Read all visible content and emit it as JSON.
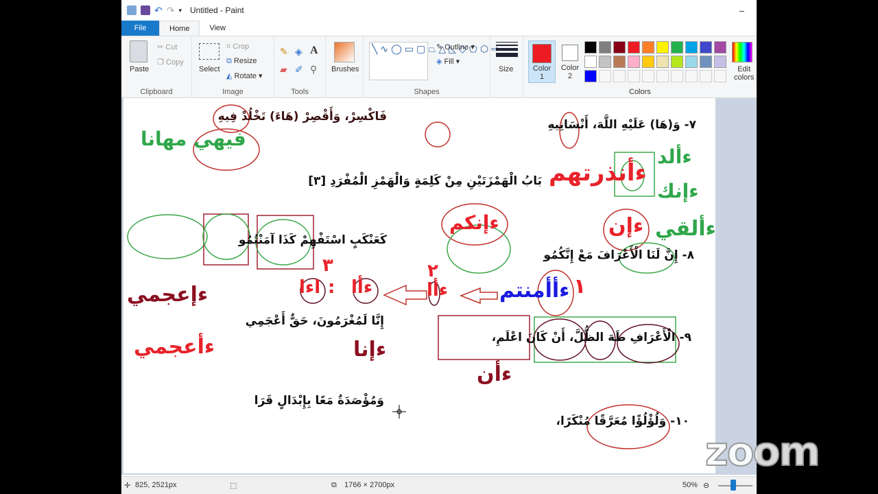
{
  "window": {
    "title": "Untitled - Paint",
    "minimize": "–"
  },
  "tabs": [
    "File",
    "Home",
    "View"
  ],
  "ribbon": {
    "clipboard": {
      "label": "Clipboard",
      "paste": "Paste",
      "cut": "Cut",
      "copy": "Copy"
    },
    "image": {
      "label": "Image",
      "select": "Select",
      "crop": "Crop",
      "resize": "Resize",
      "rotate": "Rotate"
    },
    "tools": {
      "label": "Tools"
    },
    "brushes": "Brushes",
    "shapes": {
      "label": "Shapes",
      "outline": "Outline",
      "fill": "Fill"
    },
    "size": "Size",
    "color1": "Color\n1",
    "color1_a": "Color",
    "color1_b": "1",
    "color2_a": "Color",
    "color2_b": "2",
    "colors_label": "Colors",
    "edit_colors_a": "Edit",
    "edit_colors_b": "colors",
    "color1_value": "#ed1c24",
    "color2_value": "#ffffff",
    "palette": [
      "#000000",
      "#7f7f7f",
      "#880015",
      "#ed1c24",
      "#ff7f27",
      "#fff200",
      "#22b14c",
      "#00a2e8",
      "#3f48cc",
      "#a349a4",
      "#ffffff",
      "#c3c3c3",
      "#b97a57",
      "#ffaec9",
      "#ffc90e",
      "#efe4b0",
      "#b5e61d",
      "#99d9ea",
      "#7092be",
      "#c8bfe7",
      "#0000ff"
    ]
  },
  "page": {
    "line7_right": "٧- وَ(هَا) عَلَيْهِ اللَّهَ، أَنْسَانِيهِ",
    "line7_left": "فَاكْسِرْ، وَأَقْصِرْ (هَاءَ) تَخْلُدْ فِيهِ",
    "note_fihi": "فيهي مهانا",
    "heading": "بَابُ الْهَمْزَتَيْنِ مِنْ كَلِمَةٍ وَالْهَمْزِ الْمُفْرَدِ [٣]",
    "note_andhartahum": "ءأنذرتهم",
    "note_alid": "ءألد",
    "note_innaka": "ءإنك",
    "note_ulqi": "ءألقي",
    "note_innakum": "ءإنكم",
    "note_in": "ءإن",
    "line8_right": "٨- إِنَّ لَنَا الْأَعْرَافَ مَعْ إِنَّكُمُو",
    "line8_left": "كَعَنْكَبٍ اسْتَفْهِمْ كَذَا آمَنْتُمُو",
    "note_aamantum": "ءأأمنتم",
    "num1": "١",
    "num2": "٢",
    "num3": "٣",
    "note_step2": "ءأا",
    "note_step3a": "ءأا",
    "note_colon": ":",
    "note_step3b": "اءا",
    "note_iajami_top": "ءإعجمي",
    "line9_left": "إِنَّا لَمُغْرَمُونَ، حَقٌّ أَعْجَمِي",
    "note_aajami": "ءأعجمي",
    "note_inna": "ءإنا",
    "line9_right": "٩- الْأَعْرَافِ طَهَ الظُّلَّ، أَنْ كَانَ اعْلَمِ،",
    "note_an": "ءأن",
    "line10_left": "وَمُؤْصَدَةٌ مَعًا بِإِبْدَالٍ قَرَا",
    "line10_right": "١٠- وَلُؤْلُؤًا مُعَرَّقًا مُنْكَرًا،"
  },
  "status": {
    "cursor": "825, 2521px",
    "size": "1766 × 2700px",
    "zoom": "50%"
  },
  "overlay": {
    "logo": "zoom"
  }
}
